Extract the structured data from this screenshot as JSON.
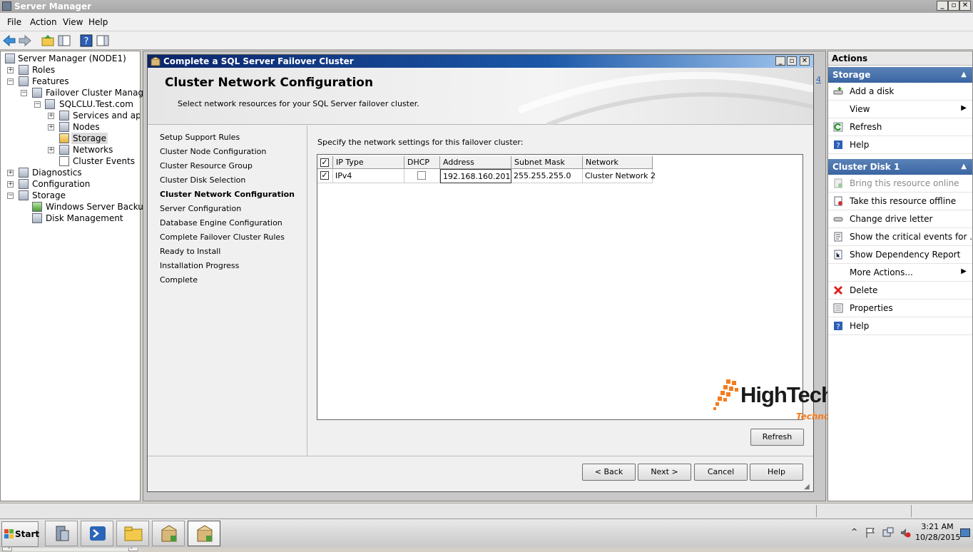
{
  "window": {
    "title": "Server Manager"
  },
  "menu": [
    "File",
    "Action",
    "View",
    "Help"
  ],
  "tree": {
    "root": "Server Manager (NODE1)",
    "roles": "Roles",
    "features": "Features",
    "failover_cluster_manager": "Failover Cluster Manager",
    "cluster": "SQLCLU.Test.com",
    "services": "Services and applica",
    "nodes": "Nodes",
    "storage_node": "Storage",
    "networks": "Networks",
    "cluster_events": "Cluster Events",
    "diagnostics": "Diagnostics",
    "configuration": "Configuration",
    "storage": "Storage",
    "windows_server_backup": "Windows Server Backup",
    "disk_management": "Disk Management"
  },
  "middle": {
    "page_indicator": "4"
  },
  "dialog": {
    "title": "Complete a SQL Server Failover Cluster",
    "header_title": "Cluster Network Configuration",
    "header_subtitle": "Select network resources for your SQL Server failover cluster.",
    "steps": [
      "Setup Support Rules",
      "Cluster Node Configuration",
      "Cluster Resource Group",
      "Cluster Disk Selection",
      "Cluster Network Configuration",
      "Server Configuration",
      "Database Engine Configuration",
      "Complete Failover Cluster Rules",
      "Ready to Install",
      "Installation Progress",
      "Complete"
    ],
    "instruction": "Specify the network settings for this failover cluster:",
    "columns": [
      "IP Type",
      "DHCP",
      "Address",
      "Subnet Mask",
      "Network"
    ],
    "rows": [
      {
        "ip_type": "IPv4",
        "address": "192.168.160.201",
        "subnet": "255.255.255.0",
        "network": "Cluster Network 2"
      }
    ],
    "refresh_label": "Refresh",
    "back_label": "< Back",
    "next_label": "Next >",
    "cancel_label": "Cancel",
    "help_label": "Help"
  },
  "logo": {
    "text": "HighTechnology",
    "tagline": "Technology that teach you"
  },
  "actions": {
    "header": "Actions",
    "storage_section": "Storage",
    "storage_items": [
      "Add a disk",
      "View",
      "Refresh",
      "Help"
    ],
    "disk_section": "Cluster Disk 1",
    "disk_items": [
      "Bring this resource online",
      "Take this resource offline",
      "Change drive letter",
      "Show the critical events for ...",
      "Show Dependency Report",
      "More Actions...",
      "Delete",
      "Properties",
      "Help"
    ]
  },
  "taskbar": {
    "start_label": "Start",
    "time": "3:21 AM",
    "date": "10/28/2015"
  }
}
